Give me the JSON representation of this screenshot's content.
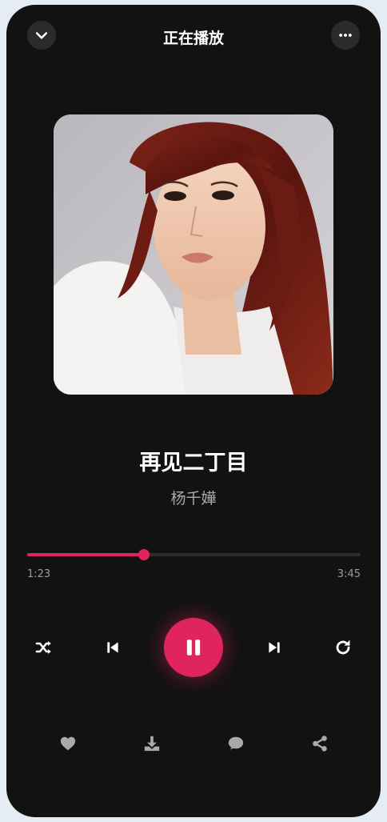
{
  "header": {
    "title": "正在播放",
    "back_icon": "chevron-down-icon",
    "more_icon": "more-horizontal-icon"
  },
  "track": {
    "title": "再见二丁目",
    "artist": "杨千嬅",
    "cover_art": "album-cover-photo"
  },
  "progress": {
    "current_time": "1:23",
    "total_time": "3:45",
    "fraction": 0.35
  },
  "controls": {
    "shuffle_icon": "shuffle-icon",
    "previous_icon": "skip-previous-icon",
    "play_state_icon": "pause-icon",
    "next_icon": "skip-next-icon",
    "repeat_icon": "repeat-icon"
  },
  "actions": {
    "like_icon": "heart-icon",
    "download_icon": "download-icon",
    "comment_icon": "comment-icon",
    "share_icon": "share-icon"
  },
  "colors": {
    "accent": "#e0245e",
    "background": "#121212",
    "panel": "#2b2b2b",
    "text_primary": "#ffffff",
    "text_secondary": "#a9a9a9"
  }
}
